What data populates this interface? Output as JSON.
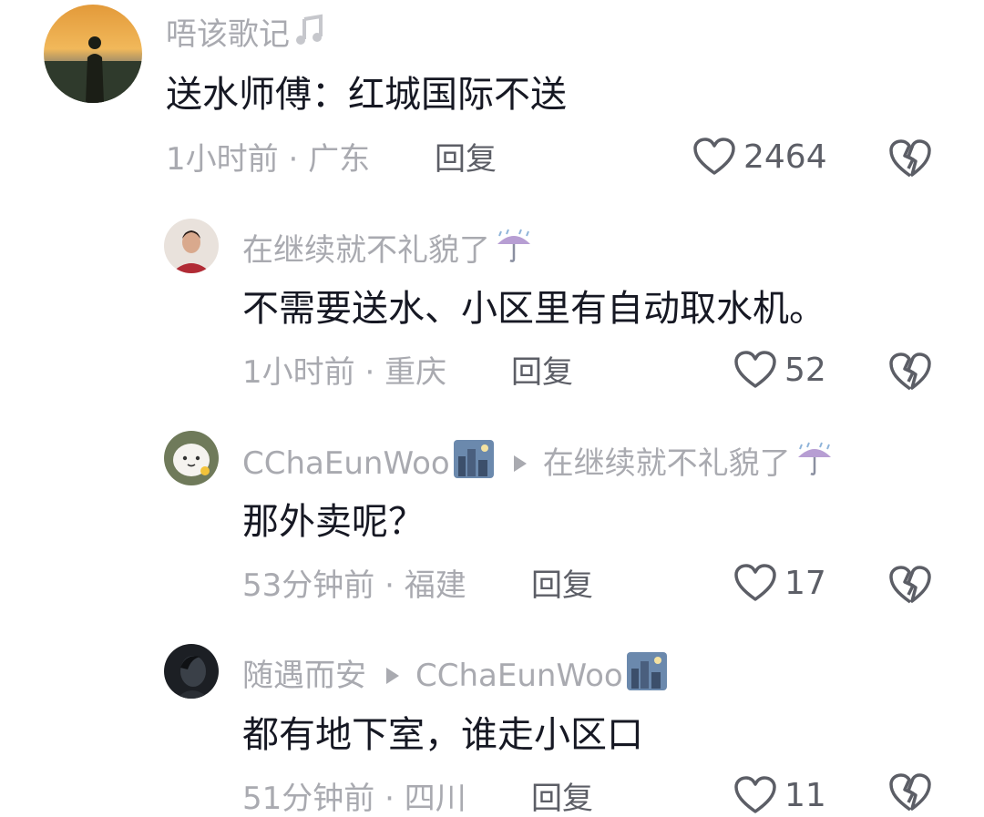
{
  "comments": [
    {
      "username": "唔该歌记",
      "username_emoji": "music-note",
      "text": "送水师傅：红城国际不送",
      "time": "1小时前",
      "location": "广东",
      "reply_label": "回复",
      "likes": "2464"
    },
    {
      "username": "在继续就不礼貌了",
      "username_emoji": "umbrella-rain",
      "text": "不需要送水、小区里有自动取水机。",
      "time": "1小时前",
      "location": "重庆",
      "reply_label": "回复",
      "likes": "52"
    },
    {
      "username": "CChaEunWoo",
      "username_emoji": "city-night",
      "reply_to": "在继续就不礼貌了",
      "reply_to_emoji": "umbrella-rain",
      "text": "那外卖呢？",
      "time": "53分钟前",
      "location": "福建",
      "reply_label": "回复",
      "likes": "17"
    },
    {
      "username": "随遇而安",
      "reply_to": "CChaEunWoo",
      "reply_to_emoji": "city-night",
      "text": "都有地下室，谁走小区口",
      "time": "51分钟前",
      "location": "四川",
      "reply_label": "回复",
      "likes": "11"
    }
  ],
  "meta_separator": " · ",
  "colors": {
    "text": "#161823",
    "muted": "#a9aab0",
    "action": "#5c5e66"
  }
}
